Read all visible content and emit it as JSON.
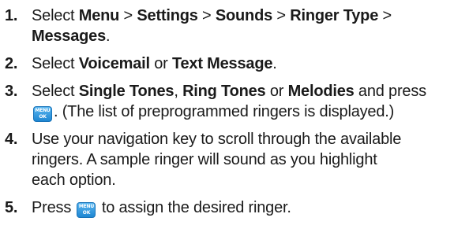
{
  "steps": [
    {
      "number": "1.",
      "line1": {
        "t1": "Select ",
        "b1": "Menu",
        "t2": " > ",
        "b2": "Settings",
        "t3": " > ",
        "b3": "Sounds",
        "t4": " > ",
        "b4": "Ringer Type",
        "t5": " >"
      },
      "line2": {
        "b1": "Messages",
        "t1": "."
      }
    },
    {
      "number": "2.",
      "line1": {
        "t1": "Select ",
        "b1": "Voicemail",
        "t2": " or ",
        "b2": "Text Message",
        "t3": "."
      }
    },
    {
      "number": "3.",
      "line1": {
        "t1": "Select ",
        "b1": "Single Tones",
        "t2": ", ",
        "b2": "Ring Tones",
        "t3": " or ",
        "b3": "Melodies",
        "t4": " and press"
      },
      "line2": {
        "t1": ". (The list of preprogrammed ringers is displayed.)"
      }
    },
    {
      "number": "4.",
      "line1": "Use your navigation key to scroll through the available",
      "line2": "ringers. A sample ringer will sound as you highlight",
      "line3": "each option."
    },
    {
      "number": "5.",
      "line1": {
        "t1": "Press ",
        "t2": " to assign the desired ringer."
      }
    }
  ],
  "key": {
    "top": "MENU",
    "bottom": "OK",
    "color": "#2a95dc"
  }
}
